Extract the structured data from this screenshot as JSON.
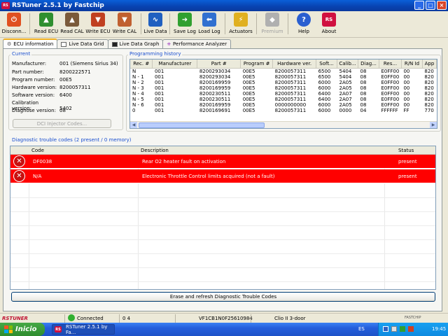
{
  "window": {
    "title": "RSTuner 2.5.1 by Fastchip",
    "app_badge": "RS"
  },
  "toolbar": [
    {
      "label": "Disconn...",
      "color": "#e05020",
      "glyph": "power-icon",
      "disabled": false
    },
    {
      "label": "Read ECU",
      "color": "#2f8f2f",
      "glyph": "read-ecu-icon",
      "disabled": false
    },
    {
      "label": "Read CAL",
      "color": "#7a5a3a",
      "glyph": "read-cal-icon",
      "disabled": false
    },
    {
      "label": "Write ECU",
      "color": "#c04020",
      "glyph": "write-ecu-icon",
      "disabled": false
    },
    {
      "label": "Write CAL",
      "color": "#c06030",
      "glyph": "write-cal-icon",
      "disabled": false
    },
    {
      "label": "Live Data",
      "color": "#2060c0",
      "glyph": "live-data-icon",
      "disabled": false
    },
    {
      "label": "Save Log",
      "color": "#30a030",
      "glyph": "save-log-icon",
      "disabled": false
    },
    {
      "label": "Load Log",
      "color": "#3070d0",
      "glyph": "load-log-icon",
      "disabled": false
    },
    {
      "label": "Actuators",
      "color": "#e0b020",
      "glyph": "actuators-icon",
      "disabled": false
    },
    {
      "label": "Premium",
      "color": "#b0b0b0",
      "glyph": "renault-logo-icon",
      "disabled": true
    },
    {
      "label": "Help",
      "color": "#2a5fd0",
      "glyph": "help-icon",
      "disabled": false
    },
    {
      "label": "About",
      "color": "#d01040",
      "glyph": "about-icon",
      "disabled": false
    }
  ],
  "tabs": [
    {
      "label": "ECU information",
      "active": true
    },
    {
      "label": "Live Data Grid",
      "active": false
    },
    {
      "label": "Live Data Graph",
      "active": false
    },
    {
      "label": "Performance Analyzer",
      "active": false
    }
  ],
  "current": {
    "heading": "Current",
    "fields": [
      {
        "key": "Manufacturer:",
        "value": "001 (Siemens Sirius 34)"
      },
      {
        "key": "Part number:",
        "value": "8200222571"
      },
      {
        "key": "Program number:",
        "value": "00E5"
      },
      {
        "key": "Hardware version:",
        "value": "8200057311"
      },
      {
        "key": "Software version:",
        "value": "6400"
      },
      {
        "key": "Calibration version:",
        "value": "5402"
      },
      {
        "key": "Diagnose version:",
        "value": "08"
      }
    ],
    "dci_button": "DCI Injector Codes..."
  },
  "history": {
    "heading": "Programming history",
    "columns": [
      "Rec. #",
      "Manufacturer",
      "Part #",
      "Program #",
      "Hardware ver.",
      "Soft...",
      "Calib...",
      "Diag...",
      "Res...",
      "R/N Id",
      "App"
    ],
    "rows": [
      [
        "N",
        "001",
        "8200293034",
        "00E5",
        "8200057311",
        "6500",
        "5404",
        "08",
        "E0FF00",
        "00",
        "820"
      ],
      [
        "N - 1",
        "001",
        "8200293034",
        "00E5",
        "8200057311",
        "6500",
        "5404",
        "08",
        "E0FF00",
        "00",
        "820"
      ],
      [
        "N - 2",
        "001",
        "8200169959",
        "00E5",
        "8200057311",
        "6000",
        "2A05",
        "08",
        "E0FF00",
        "00",
        "820"
      ],
      [
        "N - 3",
        "001",
        "8200169959",
        "00E5",
        "8200057311",
        "6000",
        "2A05",
        "08",
        "E0FF00",
        "00",
        "820"
      ],
      [
        "N - 4",
        "001",
        "8200230511",
        "00E5",
        "8200057311",
        "6400",
        "2A07",
        "08",
        "E0FF00",
        "00",
        "820"
      ],
      [
        "N - 5",
        "001",
        "8200230511",
        "00E5",
        "8200057311",
        "6400",
        "2A07",
        "08",
        "E0FF00",
        "00",
        "820"
      ],
      [
        "N - 6",
        "001",
        "8200169959",
        "00E5",
        "0000000000",
        "6000",
        "2A05",
        "08",
        "E0FF00",
        "00",
        "820"
      ],
      [
        "0",
        "001",
        "8200169691",
        "00E5",
        "8200057311",
        "6000",
        "0000",
        "04",
        "FFFFFF",
        "FF",
        "770"
      ]
    ]
  },
  "dtc": {
    "heading": "Diagnostic trouble codes (2 present / 0 memory)",
    "columns": {
      "code": "Code",
      "description": "Description",
      "status": "Status"
    },
    "rows": [
      {
        "code": "DF0038",
        "description": "Rear O2 heater fault on activation",
        "status": "present"
      },
      {
        "code": "N/A",
        "description": "Electronic Throttle Control limits acquired (not a fault)",
        "status": "present"
      }
    ],
    "erase_button": "Erase and refresh Diagnostic Trouble Codes"
  },
  "status": {
    "connection": "Connected",
    "counter": "0 4",
    "vin": "VF1CB1N0F25610984",
    "vehicle": "Clio II 3-door",
    "brand_left": "RSTUNER",
    "brand_right": "FASTCHIP"
  },
  "taskbar": {
    "start_label": "Inicio",
    "task_label": "RSTuner 2.5.1 by Fa...",
    "language": "ES",
    "clock": "19:45"
  }
}
